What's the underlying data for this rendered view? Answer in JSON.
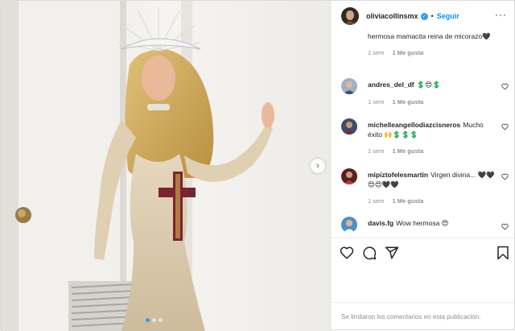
{
  "post": {
    "username": "oliviacollinsmx",
    "verified_icon": "verified-badge-icon",
    "separator": "•",
    "follow_label": "Seguir",
    "more_icon": "more-options-icon"
  },
  "caption_tail": {
    "text": "hermosa mamacita reina de micorazo🖤",
    "time": "1 sem",
    "likes": "1 Me gusta"
  },
  "comments": [
    {
      "user": "andres_del_df",
      "text": "💲😍💲",
      "time": "1 sem",
      "likes": "1 Me gusta"
    },
    {
      "user": "michelleangellodiazcisneros",
      "text": "Mucho éxito 🙌💲💲💲",
      "time": "1 sem",
      "likes": "1 Me gusta"
    },
    {
      "user": "mipiztofelesmartin",
      "text": "Virgen divina... 🖤🖤😍😍🖤🖤",
      "time": "1 sem",
      "likes": "1 Me gusta"
    },
    {
      "user": "davis.fg",
      "text": "Wow hermosa 😍",
      "time": "",
      "likes": ""
    }
  ],
  "actions": {
    "like_icon": "heart-icon",
    "comment_icon": "comment-icon",
    "share_icon": "share-icon",
    "save_icon": "bookmark-icon"
  },
  "footer": {
    "text": "Se limitaron los comentarios en esta publicación."
  },
  "carousel": {
    "next_icon": "chevron-right-icon",
    "next_glyph": "›"
  },
  "colors": {
    "accent": "#0095f6",
    "verified": "#3897f0",
    "muted": "#8e8e8e"
  }
}
